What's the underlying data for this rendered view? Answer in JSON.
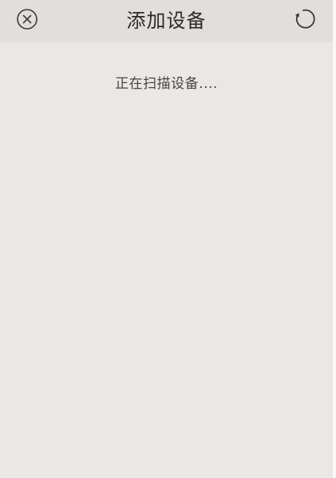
{
  "header": {
    "title": "添加设备",
    "close_icon": "close-circle-icon",
    "refresh_icon": "refresh-icon"
  },
  "main": {
    "status_text": "正在扫描设备...."
  },
  "colors": {
    "header_bg": "#e2dedb",
    "page_bg": "#ebe7e4",
    "title_text": "#2a2a2a",
    "status_text": "#454545"
  }
}
